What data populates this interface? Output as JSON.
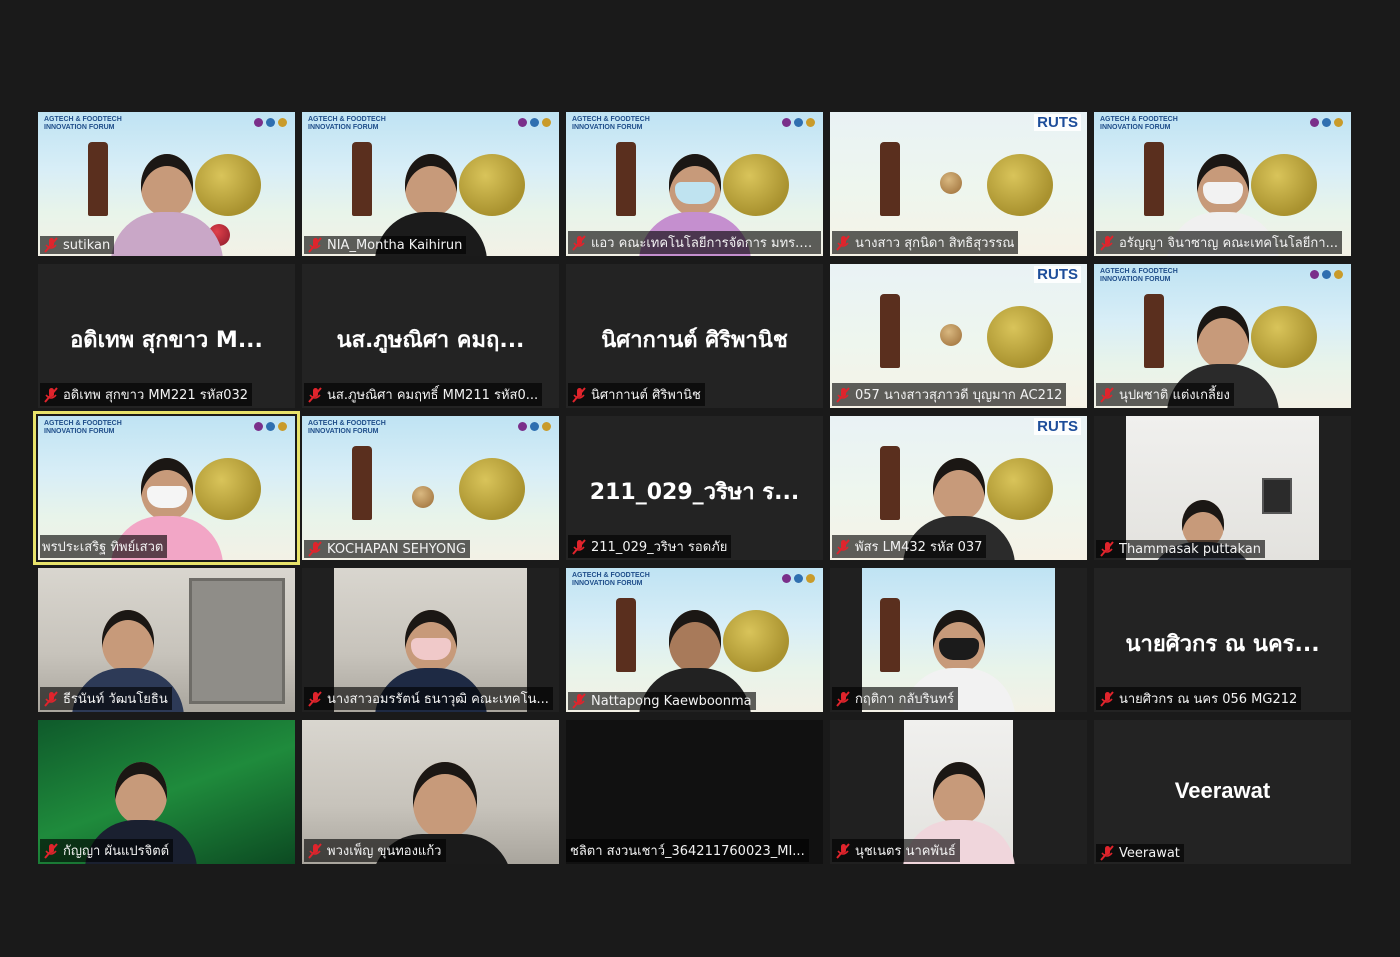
{
  "tiles": [
    {
      "label": "sutikan",
      "center": ""
    },
    {
      "label": "NIA_Montha Kaihirun",
      "center": ""
    },
    {
      "label": "แอว คณะเทคโนโลยีการจัดการ มทร.ศ...",
      "center": ""
    },
    {
      "label": "นางสาว สุกนิดา สิทธิสุวรรณ",
      "center": ""
    },
    {
      "label": "อรัญญา จินาซาญ คณะเทคโนโลยีกา...",
      "center": ""
    },
    {
      "label": "อดิเทพ สุกขาว MM221 รหัส032",
      "center": "อดิเทพ สุกขาว M..."
    },
    {
      "label": "นส.ภูษณิศา คมฤทธิ์ MM211 รหัส0...",
      "center": "นส.ภูษณิศา คมฤ..."
    },
    {
      "label": "นิศากานต์ ศิริพานิช",
      "center": "นิศากานต์ ศิริพานิช"
    },
    {
      "label": "057 นางสาวสุภาวดี บุญมาก AC212",
      "center": ""
    },
    {
      "label": "นุปผชาติ แต่งเกลี้ยง",
      "center": ""
    },
    {
      "label": "พรประเสริฐ ทิพย์เสวต",
      "center": ""
    },
    {
      "label": "KOCHAPAN SEHYONG",
      "center": ""
    },
    {
      "label": "211_029_วริษา รอดภัย",
      "center": "211_029_วริษา ร..."
    },
    {
      "label": "พัสร LM432 รหัส 037",
      "center": ""
    },
    {
      "label": "Thammasak puttakan",
      "center": ""
    },
    {
      "label": "ธีรนันท์ วัฒนโยธิน",
      "center": ""
    },
    {
      "label": "นางสาวอมรรัตน์ ธนาวุฒิ คณะเทคโน...",
      "center": ""
    },
    {
      "label": "Nattapong Kaewboonma",
      "center": ""
    },
    {
      "label": "กฤติกา กลับรินทร์",
      "center": ""
    },
    {
      "label": "นายศิวกร ณ นคร 056 MG212",
      "center": "นายศิวกร ณ นคร..."
    },
    {
      "label": "กัญญา ผันแปรจิตต์",
      "center": ""
    },
    {
      "label": "พวงเพ็ญ ขุนทองแก้ว",
      "center": ""
    },
    {
      "label": "ชลิตา สงวนเชาว์_364211760023_MI...",
      "center": ""
    },
    {
      "label": "นุชเนตร นาคพันธ์",
      "center": ""
    },
    {
      "label": "Veerawat",
      "center": "Veerawat"
    }
  ],
  "banner": {
    "title_line1": "AGTECH & FOODTECH",
    "title_line2": "INNOVATION FORUM",
    "ruts": "RUTS"
  },
  "icons": {
    "muted_mic": "muted-microphone-icon"
  },
  "colors": {
    "active_speaker": "#e8e36b",
    "muted_red": "#e0242c"
  }
}
